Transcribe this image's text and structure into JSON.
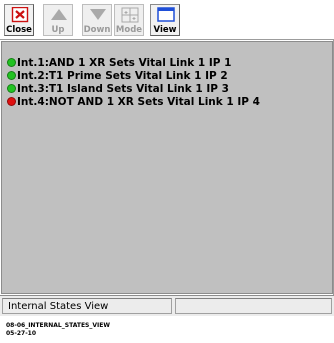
{
  "toolbar": {
    "buttons": [
      {
        "label": "Close",
        "icon": "close-icon",
        "enabled": true
      },
      {
        "label": "Up",
        "icon": "up-arrow-icon",
        "enabled": false
      },
      {
        "label": "Down",
        "icon": "down-arrow-icon",
        "enabled": false
      },
      {
        "label": "Mode",
        "icon": "mode-icon",
        "enabled": false
      },
      {
        "label": "View",
        "icon": "view-window-icon",
        "enabled": true
      }
    ]
  },
  "states": [
    {
      "text": "Int.1:AND 1 XR Sets Vital Link 1 IP 1",
      "status_color": "#22c322"
    },
    {
      "text": "Int.2:T1 Prime Sets Vital Link 1 IP 2",
      "status_color": "#22c322"
    },
    {
      "text": "Int.3:T1 Island Sets Vital Link 1 IP 3",
      "status_color": "#22c322"
    },
    {
      "text": "Int.4:NOT AND 1 XR Sets Vital Link 1 IP 4",
      "status_color": "#e01010"
    }
  ],
  "statusbar": {
    "pane1_text": "Internal States View",
    "pane2_text": ""
  },
  "caption": {
    "line1": "08-06_INTERNAL_STATES_VIEW",
    "line2": "05-27-10"
  },
  "colors": {
    "list_background": "#c0c0c0",
    "close_icon": "#cc1111",
    "view_icon": "#1f4fd8"
  }
}
